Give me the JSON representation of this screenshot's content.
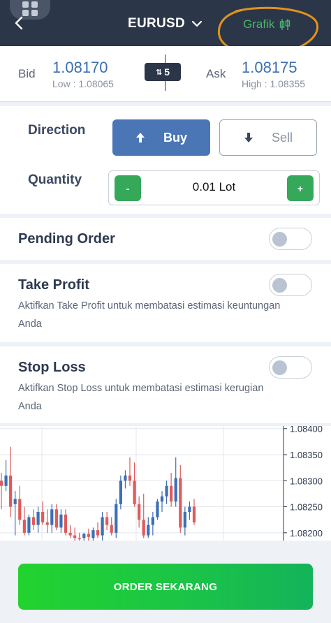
{
  "header": {
    "symbol": "EURUSD",
    "grafik_label": "Grafik",
    "colors": {
      "background": "#2b3649",
      "grafik": "#4ab86a",
      "annotation": "#e0921e"
    }
  },
  "quote": {
    "bid_label": "Bid",
    "bid_price": "1.08170",
    "low_text": "Low : 1.08065",
    "ask_label": "Ask",
    "ask_price": "1.08175",
    "high_text": "High : 1.08355",
    "spread": "5"
  },
  "order": {
    "direction_label": "Direction",
    "buy_label": "Buy",
    "sell_label": "Sell",
    "quantity_label": "Quantity",
    "minus_label": "-",
    "plus_label": "+",
    "quantity_value": "0.01",
    "quantity_unit": "Lot"
  },
  "pending_order": {
    "title": "Pending Order",
    "enabled": false
  },
  "take_profit": {
    "title": "Take Profit",
    "description": "Aktifkan Take Profit untuk membatasi estimasi keuntungan Anda",
    "enabled": false
  },
  "stop_loss": {
    "title": "Stop Loss",
    "description": "Aktifkan Stop Loss untuk membatasi estimasi kerugian Anda",
    "enabled": false
  },
  "chart_data": {
    "type": "candlestick",
    "y_tick_labels": [
      "1.08400",
      "1.08350",
      "1.08300",
      "1.08250",
      "1.08200"
    ],
    "y_ticks": [
      1.084,
      1.0835,
      1.083,
      1.0825,
      1.082
    ],
    "ylim": [
      1.08185,
      1.08405
    ],
    "grid": true,
    "colors": {
      "up": "#3d6fb6",
      "down": "#e05a5a"
    },
    "candles": [
      {
        "o": 1.083,
        "h": 1.08315,
        "l": 1.08245,
        "c": 1.0829
      },
      {
        "o": 1.0829,
        "h": 1.0834,
        "l": 1.0828,
        "c": 1.0831
      },
      {
        "o": 1.0831,
        "h": 1.08365,
        "l": 1.0823,
        "c": 1.0825
      },
      {
        "o": 1.08255,
        "h": 1.0828,
        "l": 1.08195,
        "c": 1.08265
      },
      {
        "o": 1.08265,
        "h": 1.0829,
        "l": 1.08215,
        "c": 1.08225
      },
      {
        "o": 1.08225,
        "h": 1.0825,
        "l": 1.08195,
        "c": 1.082
      },
      {
        "o": 1.082,
        "h": 1.08235,
        "l": 1.08195,
        "c": 1.0823
      },
      {
        "o": 1.0823,
        "h": 1.08245,
        "l": 1.08205,
        "c": 1.08215
      },
      {
        "o": 1.08215,
        "h": 1.0825,
        "l": 1.082,
        "c": 1.0824
      },
      {
        "o": 1.0824,
        "h": 1.0826,
        "l": 1.08215,
        "c": 1.0822
      },
      {
        "o": 1.0822,
        "h": 1.08245,
        "l": 1.082,
        "c": 1.08215
      },
      {
        "o": 1.08215,
        "h": 1.08255,
        "l": 1.082,
        "c": 1.08245
      },
      {
        "o": 1.08245,
        "h": 1.08255,
        "l": 1.08205,
        "c": 1.0821
      },
      {
        "o": 1.0821,
        "h": 1.08245,
        "l": 1.082,
        "c": 1.08235
      },
      {
        "o": 1.08235,
        "h": 1.08245,
        "l": 1.08195,
        "c": 1.082
      },
      {
        "o": 1.082,
        "h": 1.08215,
        "l": 1.0819,
        "c": 1.08195
      },
      {
        "o": 1.08195,
        "h": 1.0821,
        "l": 1.08185,
        "c": 1.0819
      },
      {
        "o": 1.0819,
        "h": 1.082,
        "l": 1.08185,
        "c": 1.08188
      },
      {
        "o": 1.0819,
        "h": 1.082,
        "l": 1.08185,
        "c": 1.08198
      },
      {
        "o": 1.08198,
        "h": 1.08208,
        "l": 1.08185,
        "c": 1.08192
      },
      {
        "o": 1.0819,
        "h": 1.0821,
        "l": 1.08185,
        "c": 1.08205
      },
      {
        "o": 1.08205,
        "h": 1.0822,
        "l": 1.0819,
        "c": 1.08195
      },
      {
        "o": 1.08195,
        "h": 1.0824,
        "l": 1.08185,
        "c": 1.0823
      },
      {
        "o": 1.0823,
        "h": 1.0824,
        "l": 1.08205,
        "c": 1.08215
      },
      {
        "o": 1.08215,
        "h": 1.0823,
        "l": 1.08195,
        "c": 1.082
      },
      {
        "o": 1.082,
        "h": 1.08265,
        "l": 1.0819,
        "c": 1.08255
      },
      {
        "o": 1.08255,
        "h": 1.0831,
        "l": 1.08245,
        "c": 1.083
      },
      {
        "o": 1.083,
        "h": 1.0832,
        "l": 1.08285,
        "c": 1.0831
      },
      {
        "o": 1.0831,
        "h": 1.08345,
        "l": 1.0829,
        "c": 1.083
      },
      {
        "o": 1.083,
        "h": 1.08335,
        "l": 1.0825,
        "c": 1.08255
      },
      {
        "o": 1.08255,
        "h": 1.0827,
        "l": 1.0821,
        "c": 1.08225
      },
      {
        "o": 1.08225,
        "h": 1.08275,
        "l": 1.0819,
        "c": 1.08195
      },
      {
        "o": 1.08195,
        "h": 1.0823,
        "l": 1.0819,
        "c": 1.08215
      },
      {
        "o": 1.08215,
        "h": 1.0824,
        "l": 1.08195,
        "c": 1.0823
      },
      {
        "o": 1.0823,
        "h": 1.08265,
        "l": 1.08225,
        "c": 1.0826
      },
      {
        "o": 1.0826,
        "h": 1.0828,
        "l": 1.0824,
        "c": 1.0827
      },
      {
        "o": 1.0827,
        "h": 1.083,
        "l": 1.08255,
        "c": 1.0829
      },
      {
        "o": 1.0829,
        "h": 1.08315,
        "l": 1.0825,
        "c": 1.0826
      },
      {
        "o": 1.0826,
        "h": 1.08345,
        "l": 1.0825,
        "c": 1.08305
      },
      {
        "o": 1.08305,
        "h": 1.0833,
        "l": 1.082,
        "c": 1.0821
      },
      {
        "o": 1.0821,
        "h": 1.0825,
        "l": 1.08195,
        "c": 1.0824
      },
      {
        "o": 1.0824,
        "h": 1.0826,
        "l": 1.08225,
        "c": 1.0825
      },
      {
        "o": 1.0825,
        "h": 1.08265,
        "l": 1.08215,
        "c": 1.0822
      }
    ]
  },
  "submit": {
    "label": "ORDER SEKARANG"
  }
}
